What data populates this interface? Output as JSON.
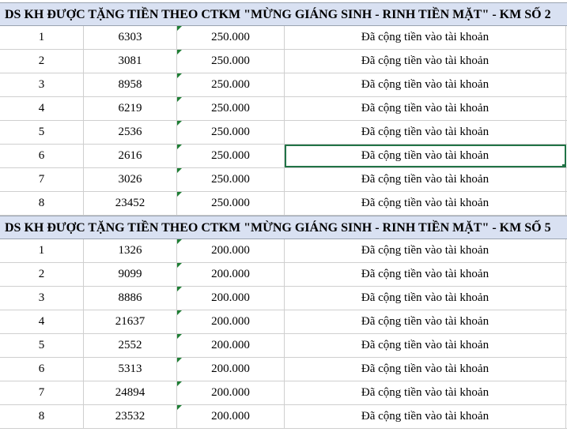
{
  "sections": [
    {
      "title": "DS KH ĐƯỢC TẶNG TIỀN THEO CTKM \"MỪNG GIÁNG SINH - RINH TIỀN MẶT\" - KM SỐ 2",
      "rows": [
        {
          "stt": "1",
          "code": "6303",
          "amount": "250.000",
          "status": "Đã cộng tiền vào tài khoản"
        },
        {
          "stt": "2",
          "code": "3081",
          "amount": "250.000",
          "status": "Đã cộng tiền vào tài khoản"
        },
        {
          "stt": "3",
          "code": "8958",
          "amount": "250.000",
          "status": "Đã cộng tiền vào tài khoản"
        },
        {
          "stt": "4",
          "code": "6219",
          "amount": "250.000",
          "status": "Đã cộng tiền vào tài khoản"
        },
        {
          "stt": "5",
          "code": "2536",
          "amount": "250.000",
          "status": "Đã cộng tiền vào tài khoản"
        },
        {
          "stt": "6",
          "code": "2616",
          "amount": "250.000",
          "status": "Đã cộng tiền vào tài khoản"
        },
        {
          "stt": "7",
          "code": "3026",
          "amount": "250.000",
          "status": "Đã cộng tiền vào tài khoản"
        },
        {
          "stt": "8",
          "code": "23452",
          "amount": "250.000",
          "status": "Đã cộng tiền vào tài khoản"
        }
      ]
    },
    {
      "title": "DS KH ĐƯỢC TẶNG TIỀN THEO CTKM \"MỪNG GIÁNG SINH - RINH TIỀN MẶT\" - KM SỐ 5",
      "rows": [
        {
          "stt": "1",
          "code": "1326",
          "amount": "200.000",
          "status": "Đã cộng tiền vào tài khoản"
        },
        {
          "stt": "2",
          "code": "9099",
          "amount": "200.000",
          "status": "Đã cộng tiền vào tài khoản"
        },
        {
          "stt": "3",
          "code": "8886",
          "amount": "200.000",
          "status": "Đã cộng tiền vào tài khoản"
        },
        {
          "stt": "4",
          "code": "21637",
          "amount": "200.000",
          "status": "Đã cộng tiền vào tài khoản"
        },
        {
          "stt": "5",
          "code": "2552",
          "amount": "200.000",
          "status": "Đã cộng tiền vào tài khoản"
        },
        {
          "stt": "6",
          "code": "5313",
          "amount": "200.000",
          "status": "Đã cộng tiền vào tài khoản"
        },
        {
          "stt": "7",
          "code": "24894",
          "amount": "200.000",
          "status": "Đã cộng tiền vào tài khoản"
        },
        {
          "stt": "8",
          "code": "23532",
          "amount": "200.000",
          "status": "Đã cộng tiền vào tài khoản"
        }
      ]
    }
  ],
  "colors": {
    "header_bg": "#d9e1f2",
    "selection": "#217346",
    "text_marker": "#1e7e34"
  },
  "selected_cell": {
    "section": 0,
    "row": 5,
    "column": "status"
  }
}
